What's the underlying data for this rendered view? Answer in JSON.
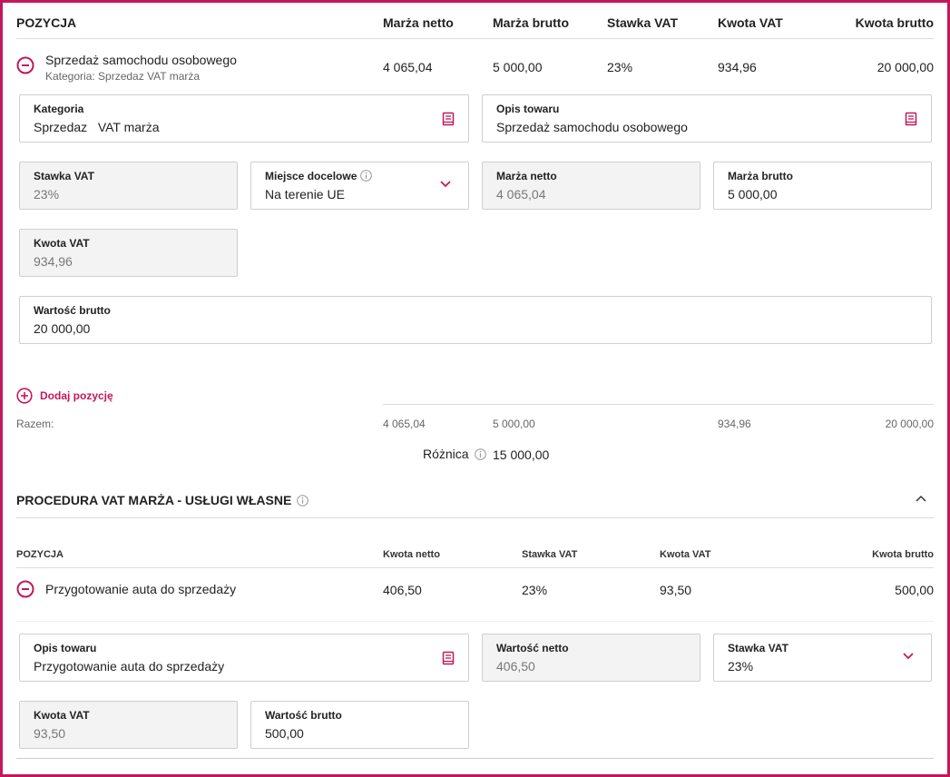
{
  "section1": {
    "headers": {
      "pozycja": "POZYCJA",
      "marza_netto": "Marża netto",
      "marza_brutto": "Marża brutto",
      "stawka_vat": "Stawka VAT",
      "kwota_vat": "Kwota VAT",
      "kwota_brutto": "Kwota brutto"
    },
    "row": {
      "name": "Sprzedaż samochodu osobowego",
      "category": "Kategoria: Sprzedaz VAT marża",
      "marza_netto": "4 065,04",
      "marza_brutto": "5 000,00",
      "stawka_vat": "23%",
      "kwota_vat": "934,96",
      "kwota_brutto": "20 000,00"
    },
    "fields": {
      "kategoria": {
        "label": "Kategoria",
        "value": "Sprzedaz   VAT marża"
      },
      "opis": {
        "label": "Opis towaru",
        "value": "Sprzedaż samochodu osobowego"
      },
      "stawka": {
        "label": "Stawka VAT",
        "value": "23%"
      },
      "miejsce": {
        "label": "Miejsce docelowe",
        "value": "Na terenie UE"
      },
      "marza_netto": {
        "label": "Marża netto",
        "value": "4 065,04"
      },
      "marza_brutto": {
        "label": "Marża brutto",
        "value": "5 000,00"
      },
      "kwota_vat": {
        "label": "Kwota VAT",
        "value": "934,96"
      },
      "wartosc_brutto": {
        "label": "Wartość brutto",
        "value": "20 000,00"
      }
    },
    "add_label": "Dodaj pozycję",
    "totals": {
      "label": "Razem:",
      "marza_netto": "4 065,04",
      "marza_brutto": "5 000,00",
      "kwota_vat": "934,96",
      "kwota_brutto": "20 000,00"
    },
    "roznica": {
      "label": "Różnica",
      "value": "15 000,00"
    }
  },
  "section2": {
    "title": "PROCEDURA VAT MARŻA - USŁUGI WŁASNE",
    "headers": {
      "pozycja": "POZYCJA",
      "kwota_netto": "Kwota netto",
      "stawka_vat": "Stawka VAT",
      "kwota_vat": "Kwota VAT",
      "kwota_brutto": "Kwota brutto"
    },
    "row": {
      "name": "Przygotowanie auta do sprzedaży",
      "kwota_netto": "406,50",
      "stawka_vat": "23%",
      "kwota_vat": "93,50",
      "kwota_brutto": "500,00"
    },
    "fields": {
      "opis": {
        "label": "Opis towaru",
        "value": "Przygotowanie auta do sprzedaży"
      },
      "wartosc_netto": {
        "label": "Wartość netto",
        "value": "406,50"
      },
      "stawka": {
        "label": "Stawka VAT",
        "value": "23%"
      },
      "kwota_vat": {
        "label": "Kwota VAT",
        "value": "93,50"
      },
      "wartosc_brutto": {
        "label": "Wartość brutto",
        "value": "500,00"
      }
    }
  },
  "colors": {
    "accent": "#c2185b",
    "border": "#cfcfcf",
    "readonly_bg": "#f3f3f3"
  },
  "icons": [
    "minus-circle-icon",
    "book-icon",
    "chevron-down-icon",
    "info-icon",
    "plus-circle-icon",
    "chevron-up-icon"
  ]
}
